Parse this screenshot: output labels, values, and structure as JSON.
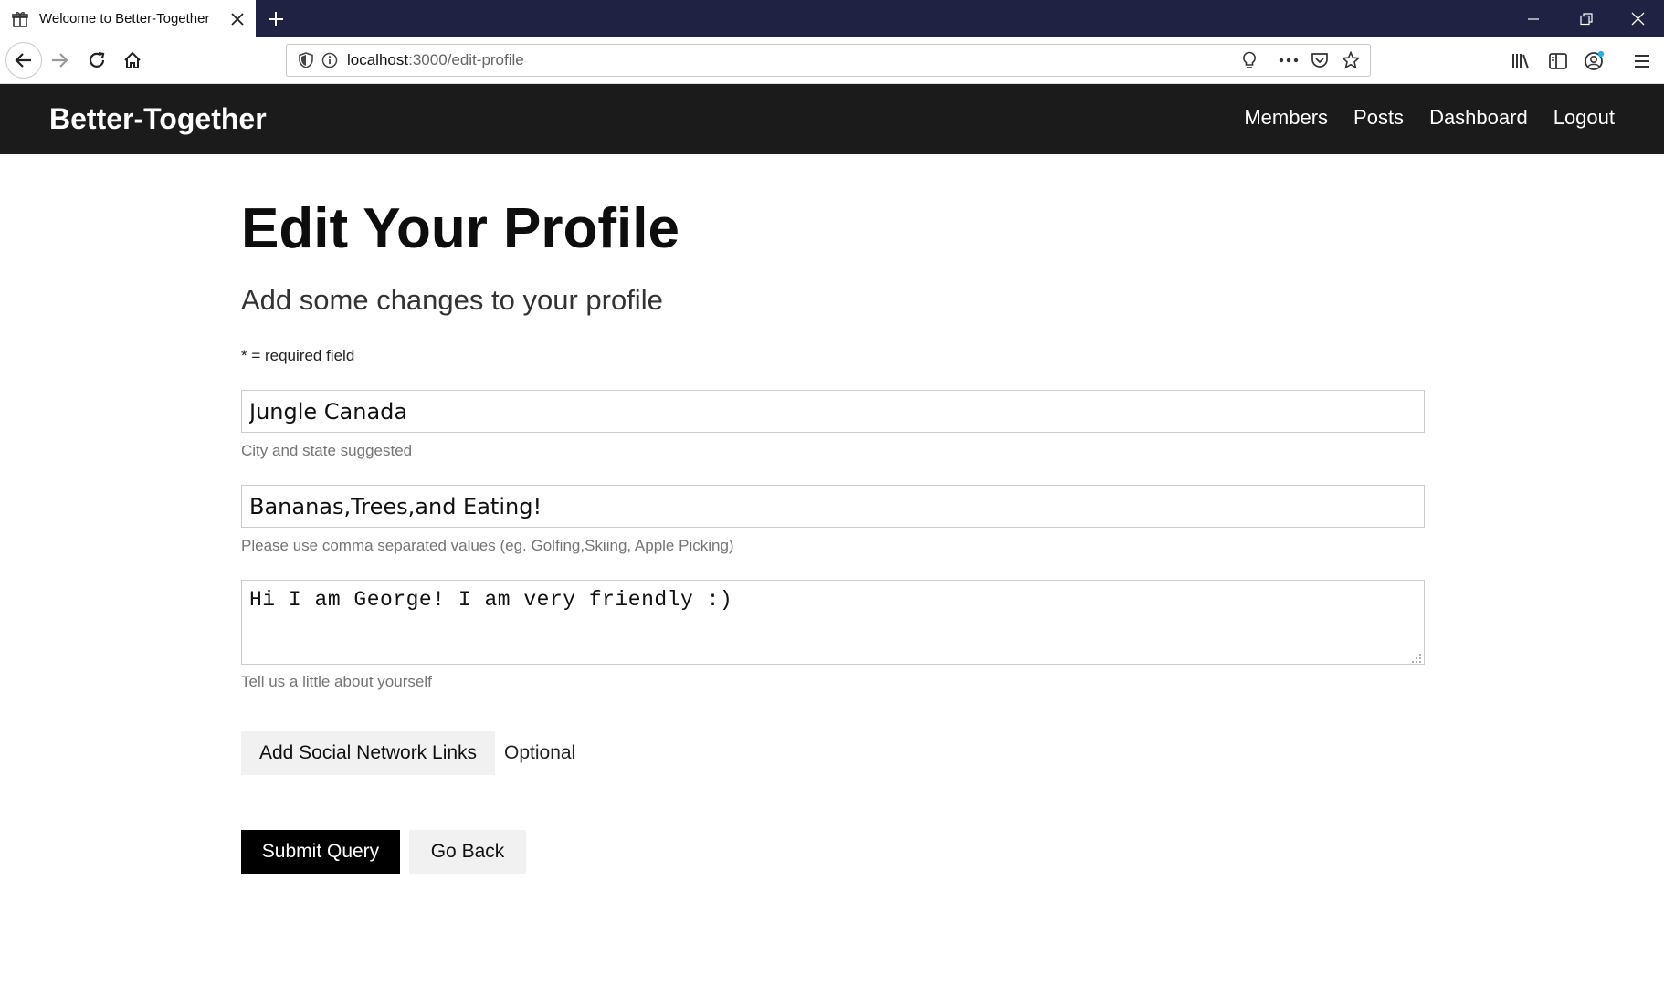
{
  "browser": {
    "tab_title": "Welcome to Better-Together",
    "url_host": "localhost",
    "url_path": ":3000/edit-profile"
  },
  "site": {
    "brand": "Better-Together",
    "nav": [
      "Members",
      "Posts",
      "Dashboard",
      "Logout"
    ]
  },
  "page": {
    "title": "Edit Your Profile",
    "subtitle": "Add some changes to your profile",
    "required_note": "* = required field"
  },
  "form": {
    "location": {
      "value": "Jungle Canada",
      "help": "City and state suggested"
    },
    "interests": {
      "value": "Bananas,Trees,and Eating!",
      "help": "Please use comma separated values (eg. Golfing,Skiing, Apple Picking)"
    },
    "bio": {
      "value": "Hi I am George! I am very friendly :)",
      "help": "Tell us a little about yourself"
    },
    "social_button": "Add Social Network Links",
    "social_optional": "Optional",
    "submit_button": "Submit Query",
    "back_button": "Go Back"
  },
  "icons": {
    "tab_favicon": "gift-icon",
    "tab_close": "close-icon",
    "new_tab": "plus-icon",
    "back": "arrow-left-icon",
    "forward": "arrow-right-icon",
    "reload": "reload-icon",
    "home": "home-icon",
    "shield": "shield-icon",
    "info": "info-icon",
    "bulb": "lightbulb-icon",
    "more": "more-icon",
    "pocket": "pocket-icon",
    "star": "star-icon",
    "library": "library-icon",
    "sidebar": "sidebar-icon",
    "account": "account-icon",
    "menu": "hamburger-menu-icon"
  },
  "colors": {
    "tabbar": "#1f2243",
    "site_header": "#1b1b1b",
    "primary_button": "#000000",
    "secondary_button": "#f1f1f1"
  }
}
